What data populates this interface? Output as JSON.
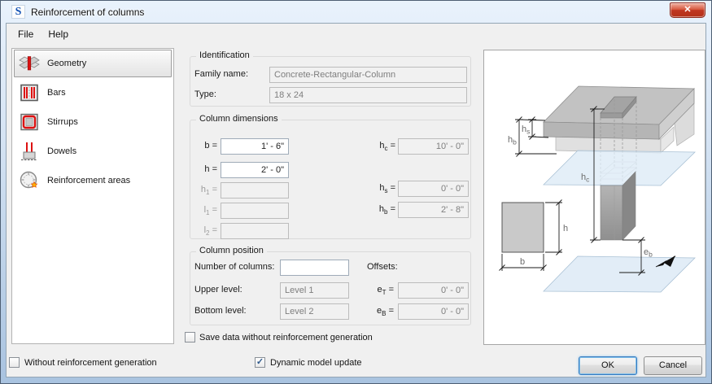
{
  "window": {
    "title": "Reinforcement of columns",
    "icon_letter": "S",
    "close_glyph": "✕"
  },
  "menu": {
    "items": [
      {
        "label": "File"
      },
      {
        "label": "Help"
      }
    ]
  },
  "sidebar": {
    "items": [
      {
        "label": "Geometry",
        "icon": "geometry-icon",
        "selected": true
      },
      {
        "label": "Bars",
        "icon": "bars-icon",
        "selected": false
      },
      {
        "label": "Stirrups",
        "icon": "stirrups-icon",
        "selected": false
      },
      {
        "label": "Dowels",
        "icon": "dowels-icon",
        "selected": false
      },
      {
        "label": "Reinforcement areas",
        "icon": "reinforcement-areas-icon",
        "selected": false
      }
    ]
  },
  "identification": {
    "title": "Identification",
    "family_label": "Family name:",
    "family_value": "Concrete-Rectangular-Column",
    "type_label": "Type:",
    "type_value": "18 x 24"
  },
  "dimensions": {
    "title": "Column dimensions",
    "left_rows": [
      {
        "base": "b",
        "sub": "",
        "value": "1' - 6\"",
        "enabled": true
      },
      {
        "base": "h",
        "sub": "",
        "value": "2' - 0\"",
        "enabled": true
      },
      {
        "base": "h",
        "sub": "1",
        "value": "",
        "enabled": false
      },
      {
        "base": "l",
        "sub": "1",
        "value": "",
        "enabled": false
      },
      {
        "base": "l",
        "sub": "2",
        "value": "",
        "enabled": false
      }
    ],
    "right_rows": [
      {
        "base": "h",
        "sub": "c",
        "value": "10' - 0\""
      },
      {
        "base": "h",
        "sub": "s",
        "value": "0' - 0\""
      },
      {
        "base": "h",
        "sub": "b",
        "value": "2' - 8\""
      }
    ]
  },
  "position": {
    "title": "Column position",
    "rows": [
      {
        "label": "Number of columns:",
        "value": "",
        "enabled": true
      },
      {
        "label": "Upper level:",
        "value": "Level 1",
        "enabled": false
      },
      {
        "label": "Bottom level:",
        "value": "Level 2",
        "enabled": false
      }
    ],
    "offsets_label": "Offsets:",
    "offset_rows": [
      {
        "base": "e",
        "sub": "T",
        "value": "0' - 0\""
      },
      {
        "base": "e",
        "sub": "B",
        "value": "0' - 0\""
      }
    ]
  },
  "checkboxes": {
    "save_data": {
      "label": "Save data without reinforcement generation",
      "checked": false
    },
    "without_generation": {
      "label": "Without reinforcement generation",
      "checked": false
    },
    "dynamic_update": {
      "label": "Dynamic model update",
      "checked": true,
      "check_glyph": "✓"
    }
  },
  "buttons": {
    "ok": "OK",
    "cancel": "Cancel"
  },
  "symbols": {
    "eq": "="
  },
  "diagram": {
    "hb": {
      "base": "h",
      "sub": "b"
    },
    "hs": {
      "base": "h",
      "sub": "s"
    },
    "hc": {
      "base": "h",
      "sub": "c"
    },
    "h": {
      "base": "h",
      "sub": ""
    },
    "b": {
      "base": "b",
      "sub": ""
    },
    "eb": {
      "base": "e",
      "sub": "b"
    }
  }
}
